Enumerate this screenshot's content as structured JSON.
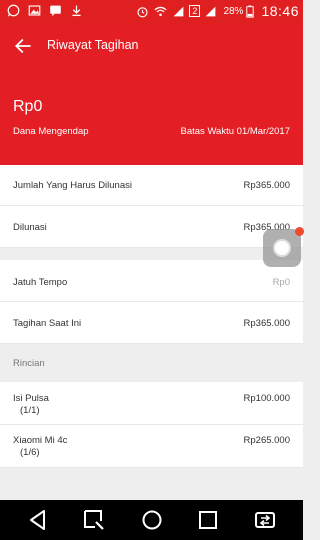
{
  "status_bar": {
    "time": "18:46",
    "battery": "28%",
    "sim_label": "2"
  },
  "header": {
    "title": "Riwayat Tagihan",
    "amount": "Rp0",
    "status": "Dana Mengendap",
    "deadline": "Batas Waktu 01/Mar/2017"
  },
  "summary": [
    {
      "label": "Jumlah Yang Harus Dilunasi",
      "value": "Rp365.000"
    },
    {
      "label": "Dilunasi",
      "value": "Rp365.000"
    }
  ],
  "details": [
    {
      "label": "Jatuh Tempo",
      "value": "Rp0"
    },
    {
      "label": "Tagihan Saat Ini",
      "value": "Rp365.000"
    }
  ],
  "breakdown": {
    "title": "Rincian",
    "items": [
      {
        "label": "Isi Pulsa",
        "sub": "(1/1)",
        "value": "Rp100.000"
      },
      {
        "label": "Xiaomi Mi 4c",
        "sub": "(1/6)",
        "value": "Rp265.000"
      }
    ]
  },
  "colors": {
    "primary": "#e31e24",
    "accent_dot": "#f0492e"
  }
}
